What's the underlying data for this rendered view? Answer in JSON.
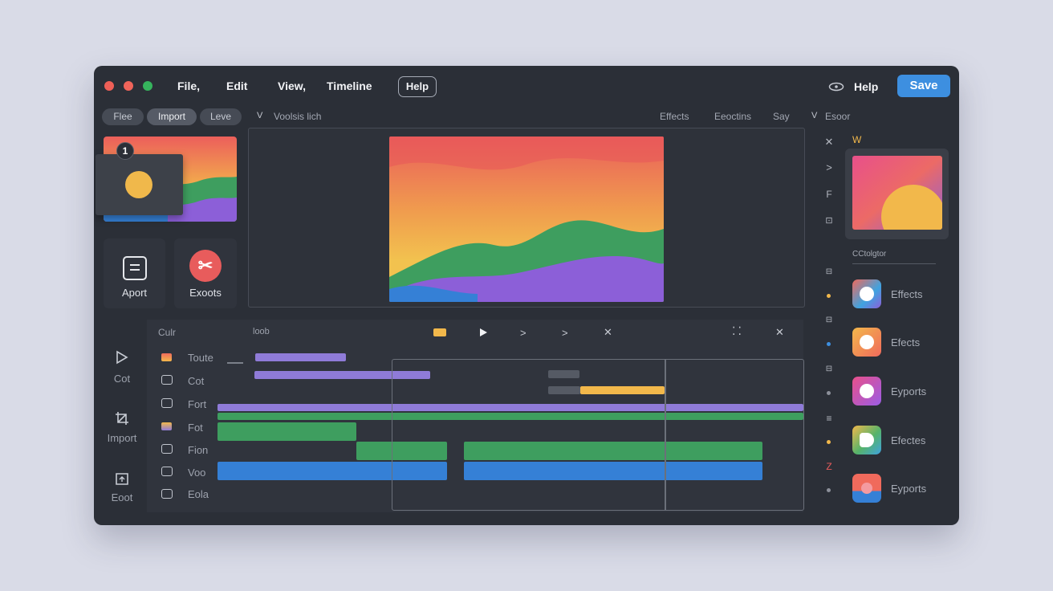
{
  "window": {
    "menu": [
      "File,",
      "Edit",
      "View,",
      "Timeline"
    ],
    "help_box": "Help",
    "help_link": "Help",
    "save_label": "Save"
  },
  "toolbar": {
    "pills": [
      "Flee",
      "Import",
      "Leve"
    ],
    "breadcrumb": "Voolsis lich",
    "right_tabs": [
      "Effects",
      "Eeoctins",
      "Say"
    ],
    "search": "Esoor"
  },
  "media": {
    "badge": "1",
    "tiles": [
      {
        "label": "Aport",
        "icon": "document-icon"
      },
      {
        "label": "Exoots",
        "icon": "scissors-icon"
      }
    ]
  },
  "side_tools": [
    {
      "label": "Cot",
      "icon": "play-outline-icon"
    },
    {
      "label": "Import",
      "icon": "crop-icon"
    },
    {
      "label": "Eoot",
      "icon": "export-icon"
    }
  ],
  "timeline": {
    "header_left": "Culr",
    "header_mid": "loob",
    "tracks": [
      "Toute",
      "Cot",
      "Fort",
      "Fot",
      "Fion",
      "Voo",
      "Eola"
    ],
    "playhead_text": ""
  },
  "inspector": {
    "header": "W",
    "section": "CCtolgtor",
    "icons": [
      "close-icon",
      "chevron-right-icon",
      "f-icon",
      "box-icon"
    ],
    "effects": [
      {
        "label": "Effects",
        "color": "#3fa3e0"
      },
      {
        "label": "Efects",
        "color": "#f08a4b"
      },
      {
        "label": "Eyports",
        "color": "#9b5de5"
      },
      {
        "label": "Efectes",
        "color": "#56b36a"
      },
      {
        "label": "Eyports",
        "color": "#f06a5c"
      }
    ]
  },
  "colors": {
    "accent": "#3d8fe0",
    "purple": "#8f7bd8",
    "green": "#3e9e5f",
    "blue": "#3580d6",
    "yellow": "#f2b84b"
  }
}
